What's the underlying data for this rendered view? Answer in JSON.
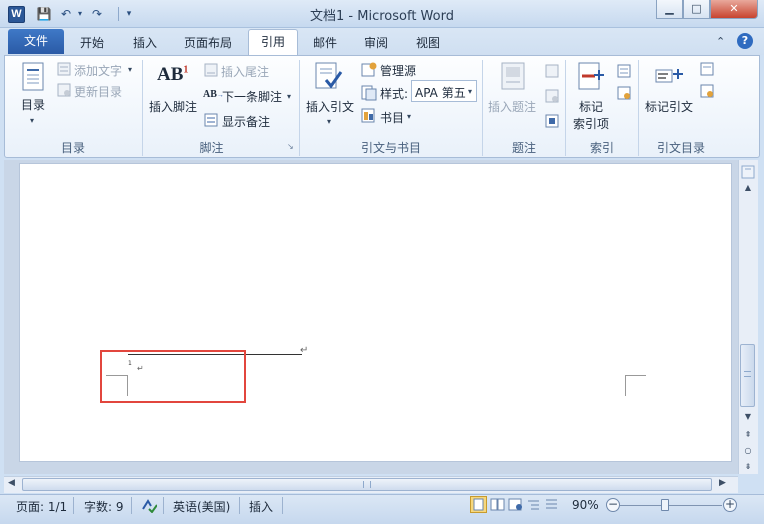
{
  "window": {
    "title": "文档1 - Microsoft Word",
    "app_icon": "W",
    "minimize": "▁",
    "maximize": "□",
    "close": "✕"
  },
  "qat": {
    "save": "💾",
    "undo": "↶",
    "redo": "↷",
    "customize": "▾"
  },
  "tabs": [
    {
      "label": "文件"
    },
    {
      "label": "开始"
    },
    {
      "label": "插入"
    },
    {
      "label": "页面布局"
    },
    {
      "label": "引用"
    },
    {
      "label": "邮件"
    },
    {
      "label": "审阅"
    },
    {
      "label": "视图"
    }
  ],
  "ribbon": {
    "toc": {
      "big_label": "目录",
      "add_text": "添加文字",
      "update_toc": "更新目录",
      "group": "目录"
    },
    "footnotes": {
      "insert_footnote": "插入脚注",
      "ab_glyph": "AB",
      "ab_sup": "1",
      "insert_endnote": "插入尾注",
      "next_footnote": "下一条脚注",
      "show_notes": "显示备注",
      "group": "脚注"
    },
    "citations": {
      "insert_citation": "插入引文",
      "manage_sources": "管理源",
      "style_label": "样式:",
      "style_value": "APA 第五",
      "bibliography": "书目",
      "group": "引文与书目"
    },
    "captions": {
      "insert_caption": "插入题注",
      "group": "题注"
    },
    "index": {
      "mark_entry_line1": "标记",
      "mark_entry_line2": "索引项",
      "group": "索引"
    },
    "toa": {
      "mark_citation": "标记引文",
      "group": "引文目录"
    }
  },
  "document": {
    "footnote_number": "1",
    "return_mark": "↵",
    "paragraph_mark": "↵"
  },
  "status": {
    "page": "页面: 1/1",
    "words": "字数: 9",
    "language": "英语(美国)",
    "mode": "插入",
    "zoom": "90%",
    "zoom_minus": "−",
    "zoom_plus": "+"
  },
  "colors": {
    "accent": "#2a5aa6",
    "highlight_box": "#e2463d"
  }
}
